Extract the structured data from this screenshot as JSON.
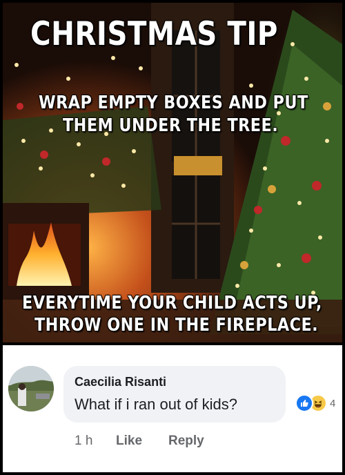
{
  "meme": {
    "title": "CHRISTMAS TIP",
    "line1": "WRAP EMPTY BOXES AND PUT",
    "line2": "THEM UNDER THE TREE.",
    "line3": "EVERYTIME YOUR CHILD ACTS UP,",
    "line4": "THROW ONE IN THE FIREPLACE."
  },
  "comment": {
    "author": "Caecilia Risanti",
    "text": "What if i ran out of kids?",
    "reaction_count": "4",
    "reactions": [
      "like-icon",
      "haha-icon"
    ],
    "time": "1 h",
    "like_label": "Like",
    "reply_label": "Reply"
  },
  "colors": {
    "bubble": "#f0f2f5",
    "like_blue": "#1877f2",
    "meta_gray": "#65676b"
  }
}
